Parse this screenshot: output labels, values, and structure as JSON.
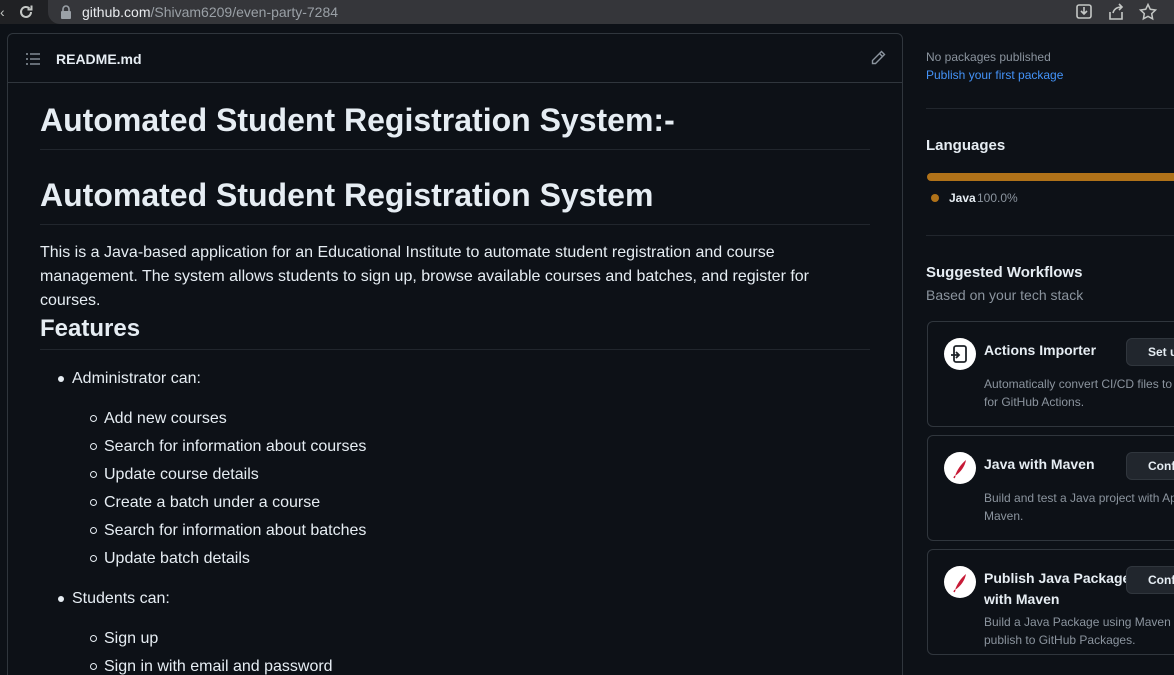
{
  "browser": {
    "url_host": "github.com",
    "url_path": "/Shivam6209/even-party-7284"
  },
  "readme": {
    "filename": "README.md",
    "heading1": "Automated Student Registration System:-",
    "heading2": "Automated Student Registration System",
    "intro_line1": "This is a Java-based application for an Educational Institute to automate student registration and course",
    "intro_line2": "management. The system allows students to sign up, browse available courses and batches, and register for courses.",
    "features_heading": "Features",
    "admin_label": "Administrator can:",
    "admin_items": [
      "Add new courses",
      "Search for information about courses",
      "Update course details",
      "Create a batch under a course",
      "Search for information about batches",
      "Update batch details"
    ],
    "student_label": "Students can:",
    "student_items": [
      "Sign up",
      "Sign in with email and password"
    ]
  },
  "sidebar": {
    "packages_status": "No packages published",
    "publish_link": "Publish your first package",
    "languages_title": "Languages",
    "language": {
      "name": "Java",
      "percent": "100.0%",
      "color": "#b07219",
      "share": 1.0
    },
    "workflows_title": "Suggested Workflows",
    "workflows_subtitle": "Based on your tech stack",
    "workflows": [
      {
        "name": "Actions Importer",
        "button": "Set up",
        "desc_line1": "Automatically convert CI/CD files to",
        "desc_line2": "for GitHub Actions.",
        "icon": "actions-importer-icon"
      },
      {
        "name": "Java with Maven",
        "button": "Configure",
        "desc_line1": "Build and test a Java project with Ap",
        "desc_line2": "Maven.",
        "icon": "maven-feather-icon"
      },
      {
        "name_line1": "Publish Java Package",
        "name_line2": "with Maven",
        "button": "Configure",
        "desc_line1": "Build a Java Package using Maven ar",
        "desc_line2": "publish to GitHub Packages.",
        "icon": "maven-feather-icon"
      }
    ]
  }
}
